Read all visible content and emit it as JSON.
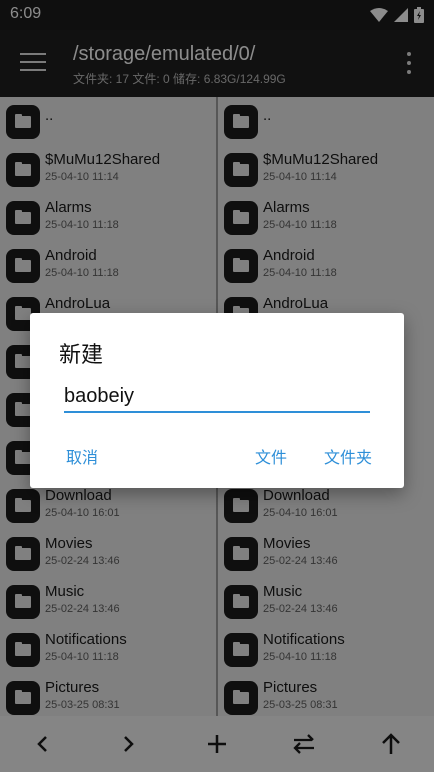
{
  "status": {
    "time": "6:09"
  },
  "toolbar": {
    "path": "/storage/emulated/0/",
    "stats": "文件夹: 17  文件: 0  储存: 6.83G/124.99G"
  },
  "left_pane": [
    {
      "name": "..",
      "date": ""
    },
    {
      "name": "$MuMu12Shared",
      "date": "25-04-10 11:14"
    },
    {
      "name": "Alarms",
      "date": "25-04-10 11:18"
    },
    {
      "name": "Android",
      "date": "25-04-10 11:18"
    },
    {
      "name": "AndroLua",
      "date": ""
    },
    {
      "name": "",
      "date": ""
    },
    {
      "name": "",
      "date": ""
    },
    {
      "name": "",
      "date": ""
    },
    {
      "name": "Download",
      "date": "25-04-10 16:01"
    },
    {
      "name": "Movies",
      "date": "25-02-24 13:46"
    },
    {
      "name": "Music",
      "date": "25-02-24 13:46"
    },
    {
      "name": "Notifications",
      "date": "25-04-10 11:18"
    },
    {
      "name": "Pictures",
      "date": "25-03-25 08:31"
    }
  ],
  "right_pane": [
    {
      "name": "..",
      "date": ""
    },
    {
      "name": "$MuMu12Shared",
      "date": "25-04-10 11:14"
    },
    {
      "name": "Alarms",
      "date": "25-04-10 11:18"
    },
    {
      "name": "Android",
      "date": "25-04-10 11:18"
    },
    {
      "name": "AndroLua",
      "date": ""
    },
    {
      "name": "",
      "date": ""
    },
    {
      "name": "",
      "date": ""
    },
    {
      "name": "",
      "date": ""
    },
    {
      "name": "Download",
      "date": "25-04-10 16:01"
    },
    {
      "name": "Movies",
      "date": "25-02-24 13:46"
    },
    {
      "name": "Music",
      "date": "25-02-24 13:46"
    },
    {
      "name": "Notifications",
      "date": "25-04-10 11:18"
    },
    {
      "name": "Pictures",
      "date": "25-03-25 08:31"
    }
  ],
  "dialog": {
    "title": "新建",
    "input_value": "baobeiy",
    "cancel_label": "取消",
    "file_label": "文件",
    "folder_label": "文件夹"
  },
  "bottombar": {
    "icons": [
      "back-icon",
      "forward-icon",
      "add-icon",
      "swap-icon",
      "up-arrow-icon"
    ]
  },
  "colors": {
    "accent": "#2e8fd8",
    "toolbar": "#1f1f1f"
  }
}
